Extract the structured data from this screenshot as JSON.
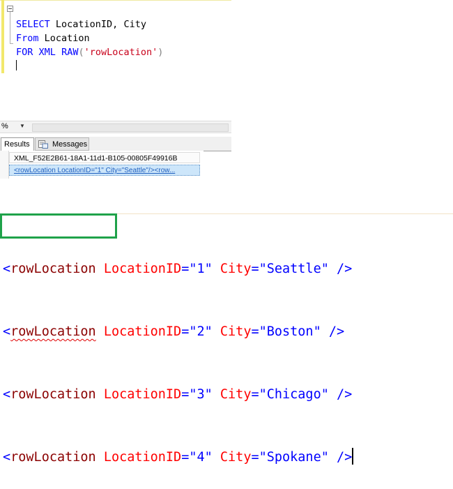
{
  "editor": {
    "line1_keyword": "SELECT",
    "line1_rest": " LocationID, City",
    "line2_keyword": "From",
    "line2_rest": " Location",
    "line3_keyword1": "FOR",
    "line3_keyword2": "XML",
    "line3_keyword3": "RAW",
    "line3_open": "(",
    "line3_string": "'rowLocation'",
    "line3_close": ")"
  },
  "results_toolbar": {
    "zoom": "%"
  },
  "tabs": {
    "results": "Results",
    "messages": "Messages"
  },
  "grid": {
    "column_header": "XML_F52E2B61-18A1-11d1-B105-00805F49916B",
    "cell_value": "<rowLocation LocationID=\"1\" City=\"Seattle\"/><row..."
  },
  "xml_output": {
    "rows": [
      {
        "tag": "rowLocation",
        "id_attr": "LocationID",
        "id_value": "\"1\"",
        "city_attr": "City",
        "city_value": "\"Seattle\""
      },
      {
        "tag": "rowLocation",
        "id_attr": "LocationID",
        "id_value": "\"2\"",
        "city_attr": "City",
        "city_value": "\"Boston\""
      },
      {
        "tag": "rowLocation",
        "id_attr": "LocationID",
        "id_value": "\"3\"",
        "city_attr": "City",
        "city_value": "\"Chicago\""
      },
      {
        "tag": "rowLocation",
        "id_attr": "LocationID",
        "id_value": "\"4\"",
        "city_attr": "City",
        "city_value": "\"Spokane\""
      }
    ]
  },
  "colors": {
    "highlight_box": "#1fa24a",
    "keyword": "#0000ff",
    "string": "#c8001a"
  }
}
